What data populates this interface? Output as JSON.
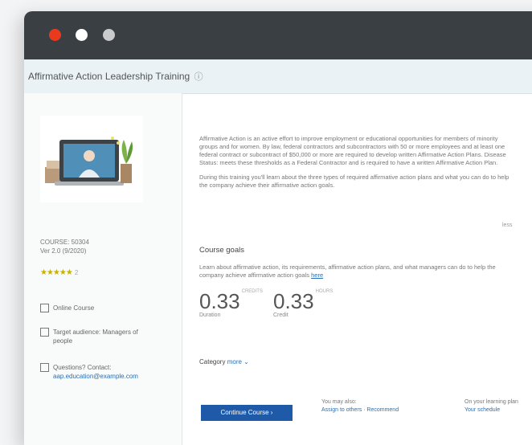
{
  "window": {
    "colors": {
      "titlebar": "#3a3f44",
      "close": "#ea3a1e",
      "accent": "#1e5aa8"
    }
  },
  "course": {
    "title": "Affirmative Action Leadership Training",
    "info_icon": "info-icon"
  },
  "sidebar": {
    "session_id": "COURSE: 50304",
    "version": "Ver 2.0 (9/2020)",
    "rating": {
      "stars": "★★★★★",
      "count": "2"
    },
    "meta": [
      {
        "icon": "course-icon",
        "label": "Online Course"
      },
      {
        "icon": "audience-icon",
        "label": "Target audience: Managers of people"
      },
      {
        "icon": "contact-icon",
        "label": "Questions? Contact:",
        "link": "aap.education@example.com"
      }
    ]
  },
  "main": {
    "description": [
      "Affirmative Action is an active effort to improve employment or educational opportunities for members of minority groups and for women. By law, federal contractors and subcontractors with 50 or more employees and at least one federal contract or subcontract of $50,000 or more are required to develop written Affirmative Action Plans. Disease Status: meets these thresholds as a Federal Contractor and is required to have a written Affirmative Action Plan.",
      "During this training you'll learn about the three types of required affirmative action plans and what you can do to help the company achieve their affirmative action goals."
    ],
    "more_label": "less",
    "goals_heading": "Course goals",
    "goals_text": "Learn about affirmative action, its requirements, affirmative action plans, and what managers can do to help the company achieve affirmative action goals",
    "goals_link": "here",
    "stats": [
      {
        "value": "0.33",
        "unit": "CREDITS",
        "label": "Duration"
      },
      {
        "value": "0.33",
        "unit": "HOURS",
        "label": "Credit"
      }
    ],
    "category_label": "Category",
    "category_link": "more",
    "cta_label": "Continue Course",
    "also": {
      "label": "You may also:",
      "link": "Assign to others · Recommend"
    },
    "plan": {
      "label": "On your learning plan",
      "link": "Your schedule"
    }
  }
}
